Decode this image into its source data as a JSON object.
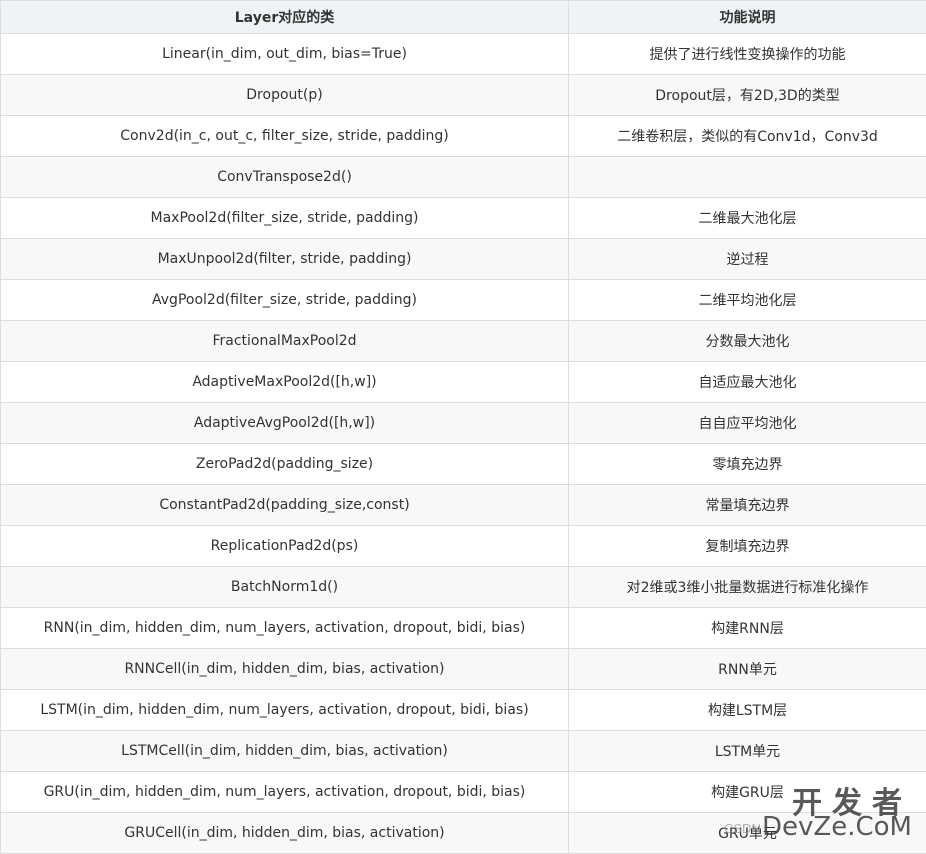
{
  "table": {
    "headers": [
      "Layer对应的类",
      "功能说明"
    ],
    "rows": [
      [
        "Linear(in_dim, out_dim, bias=True)",
        "提供了进行线性变换操作的功能"
      ],
      [
        "Dropout(p)",
        "Dropout层，有2D,3D的类型"
      ],
      [
        "Conv2d(in_c, out_c, filter_size, stride, padding)",
        "二维卷积层，类似的有Conv1d，Conv3d"
      ],
      [
        "ConvTranspose2d()",
        ""
      ],
      [
        "MaxPool2d(filter_size, stride, padding)",
        "二维最大池化层"
      ],
      [
        "MaxUnpool2d(filter, stride, padding)",
        "逆过程"
      ],
      [
        "AvgPool2d(filter_size, stride, padding)",
        "二维平均池化层"
      ],
      [
        "FractionalMaxPool2d",
        "分数最大池化"
      ],
      [
        "AdaptiveMaxPool2d([h,w])",
        "自适应最大池化"
      ],
      [
        "AdaptiveAvgPool2d([h,w])",
        "自自应平均池化"
      ],
      [
        "ZeroPad2d(padding_size)",
        "零填充边界"
      ],
      [
        "ConstantPad2d(padding_size,const)",
        "常量填充边界"
      ],
      [
        "ReplicationPad2d(ps)",
        "复制填充边界"
      ],
      [
        "BatchNorm1d()",
        "对2维或3维小批量数据进行标准化操作"
      ],
      [
        "RNN(in_dim, hidden_dim, num_layers, activation, dropout, bidi, bias)",
        "构建RNN层"
      ],
      [
        "RNNCell(in_dim, hidden_dim, bias, activation)",
        "RNN单元"
      ],
      [
        "LSTM(in_dim, hidden_dim, num_layers, activation, dropout, bidi, bias)",
        "构建LSTM层"
      ],
      [
        "LSTMCell(in_dim, hidden_dim, bias, activation)",
        "LSTM单元"
      ],
      [
        "GRU(in_dim, hidden_dim, num_layers, activation, dropout, bidi, bias)",
        "构建GRU层"
      ],
      [
        "GRUCell(in_dim, hidden_dim, bias, activation)",
        "GRU单元"
      ]
    ]
  },
  "watermark": {
    "cn": "开发者",
    "csdn": "CSDN",
    "en": "DevZe.CoM"
  }
}
